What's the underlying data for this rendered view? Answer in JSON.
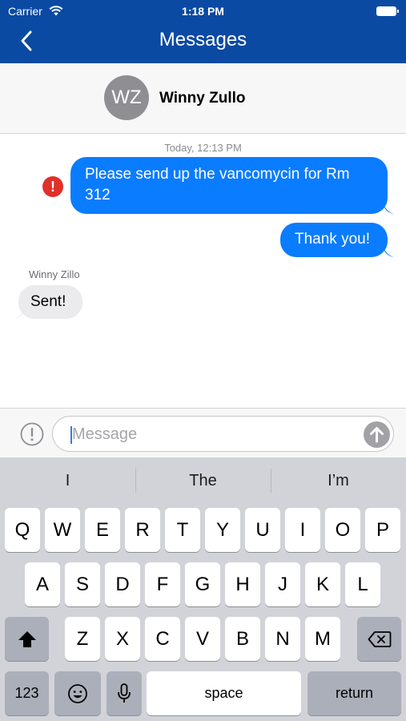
{
  "status_bar": {
    "carrier": "Carrier",
    "time": "1:18 PM",
    "icons": [
      "wifi-icon",
      "battery-icon"
    ]
  },
  "nav": {
    "title": "Messages",
    "back_icon": "chevron-left-icon"
  },
  "contact": {
    "initials": "WZ",
    "name": "Winny Zullo"
  },
  "conversation": {
    "timestamp": "Today, 12:13 PM",
    "messages": [
      {
        "direction": "outgoing",
        "text": "Please send up the vancomycin for Rm 312",
        "status": "error",
        "status_icon": "exclamation-icon",
        "status_glyph": "!"
      },
      {
        "direction": "outgoing",
        "text": "Thank you!"
      },
      {
        "direction": "incoming",
        "sender": "Winny Zillo",
        "text": "Sent!"
      }
    ]
  },
  "composer": {
    "placeholder": "Message",
    "info_icon": "info-circle-icon",
    "send_icon": "arrow-up-icon"
  },
  "keyboard": {
    "suggestions": [
      "I",
      "The",
      "I’m"
    ],
    "row1": [
      "Q",
      "W",
      "E",
      "R",
      "T",
      "Y",
      "U",
      "I",
      "O",
      "P"
    ],
    "row2": [
      "A",
      "S",
      "D",
      "F",
      "G",
      "H",
      "J",
      "K",
      "L"
    ],
    "row3": [
      "Z",
      "X",
      "C",
      "V",
      "B",
      "N",
      "M"
    ],
    "numbers_label": "123",
    "space_label": "space",
    "return_label": "return"
  },
  "colors": {
    "nav_bg": "#0a4aa3",
    "outgoing_bubble": "#0a7cff",
    "incoming_bubble": "#ebebed",
    "error": "#e0302a",
    "keyboard_bg": "#d1d3d9"
  }
}
